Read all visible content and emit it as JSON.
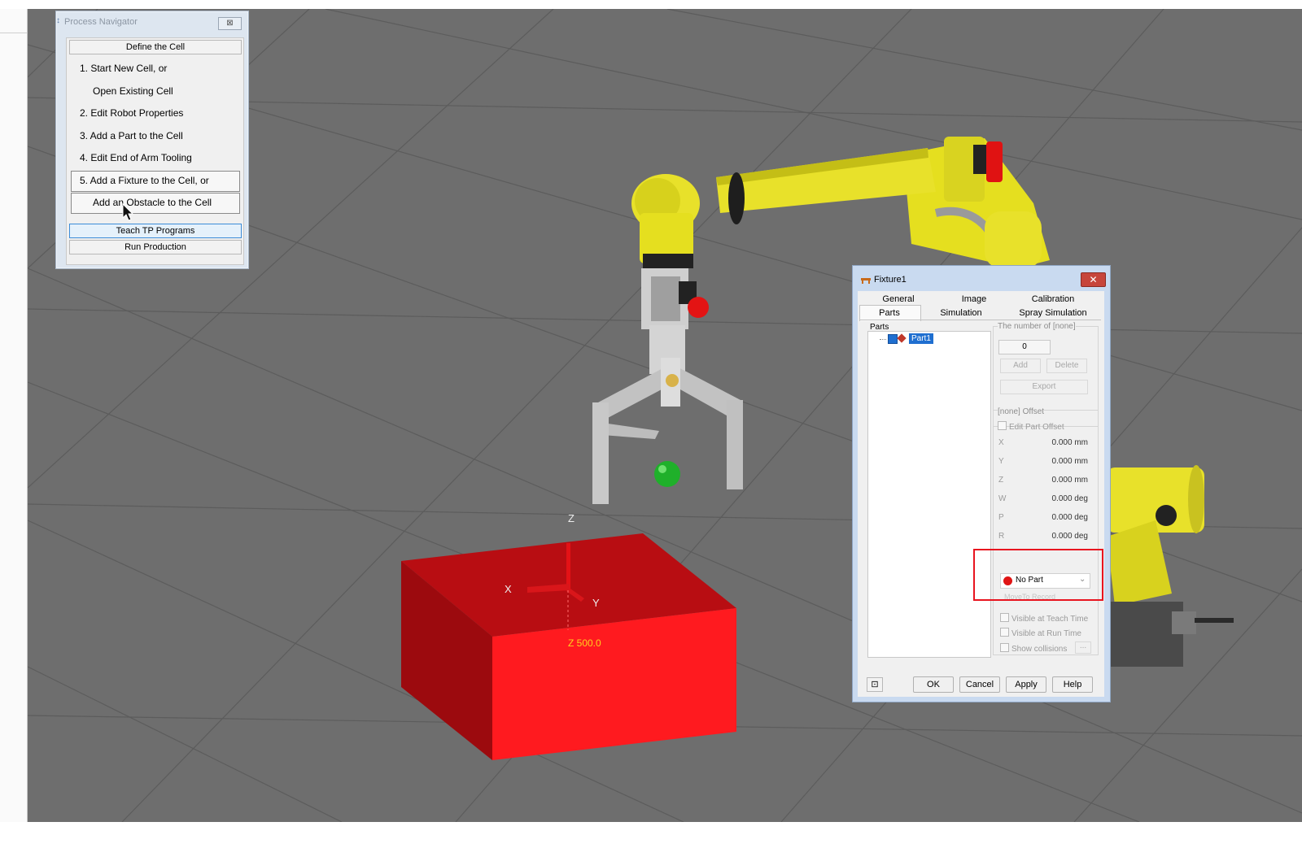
{
  "process_navigator": {
    "title": "Process Navigator",
    "close_label": "⊠",
    "define_cell": "Define the Cell",
    "steps": [
      "1.  Start New Cell, or",
      "Open Existing Cell",
      "2.  Edit Robot Properties",
      "3.  Add a Part to the Cell",
      "4.  Edit End of Arm Tooling",
      "5.  Add a Fixture to the Cell, or",
      "Add an Obstacle to the Cell"
    ],
    "teach": "Teach TP Programs",
    "run": "Run Production"
  },
  "scene": {
    "axis_z": "Z",
    "axis_x": "X",
    "axis_y": "Y",
    "z_readout": "Z 500.0"
  },
  "fixture_dialog": {
    "title": "Fixture1",
    "close_label": "✕",
    "tabs_row1": [
      "General",
      "Image",
      "Calibration"
    ],
    "tabs_row2": [
      "Parts",
      "Simulation",
      "Spray Simulation"
    ],
    "parts_label": "Parts",
    "tree_item": "Part1",
    "number_group": "The number of [none]",
    "count_value": "0",
    "add": "Add",
    "delete": "Delete",
    "export": "Export",
    "offset_group": "[none] Offset",
    "edit_offset": "Edit Part Offset",
    "offsets": [
      {
        "label": "X",
        "value": "0.000  mm"
      },
      {
        "label": "Y",
        "value": "0.000  mm"
      },
      {
        "label": "Z",
        "value": "0.000  mm"
      },
      {
        "label": "W",
        "value": "0.000  deg"
      },
      {
        "label": "P",
        "value": "0.000  deg"
      },
      {
        "label": "R",
        "value": "0.000  deg"
      }
    ],
    "no_part": "No Part",
    "hidden_buttons": "MoveTo      Record",
    "visible_teach": "Visible at Teach Time",
    "visible_run": "Visible at Run Time",
    "show_collisions": "Show collisions",
    "dots": "...",
    "ok": "OK",
    "cancel": "Cancel",
    "apply": "Apply",
    "help": "Help"
  }
}
